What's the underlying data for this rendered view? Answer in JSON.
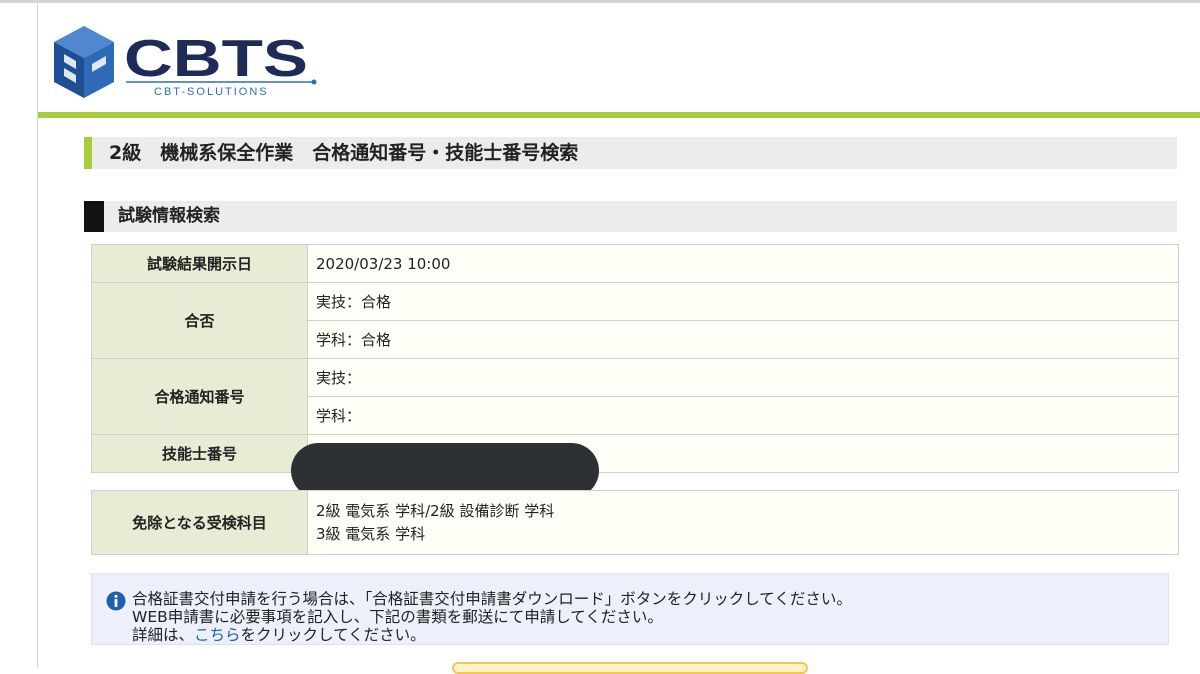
{
  "brand": {
    "name": "CBTS",
    "tagline": "CBT-SOLUTIONS",
    "colors": {
      "navy": "#1e2a58",
      "accent_green": "#a8cc3c",
      "logo_blue": "#2a6fb8"
    }
  },
  "page": {
    "title": "2級　機械系保全作業　合格通知番号・技能士番号検索"
  },
  "section": {
    "title": "試験情報検索"
  },
  "results": {
    "release_date_label": "試験結果開示日",
    "release_date_value": "2020/03/23 10:00",
    "pass_fail_label": "合否",
    "pass_fail_practical": "実技：合格",
    "pass_fail_written": "学科：合格",
    "pass_notice_no_label": "合格通知番号",
    "pass_notice_practical": "実技：",
    "pass_notice_written": "学科：",
    "technician_no_label": "技能士番号",
    "technician_no_value": ""
  },
  "exemptions": {
    "label": "免除となる受検科目",
    "lines": [
      "2級 電気系 学科/2級 設備診断 学科",
      "3級 電気系 学科"
    ]
  },
  "notice": {
    "icon": "info-icon",
    "line1": "合格証書交付申請を行う場合は、「合格証書交付申請書ダウンロード」ボタンをクリックしてください。",
    "line2": "WEB申請書に必要事項を記入し、下記の書類を郵送にて申請してください。",
    "line3_prefix": "詳細は、",
    "line3_link": "こちら",
    "line3_suffix": "をクリックしてください。"
  }
}
